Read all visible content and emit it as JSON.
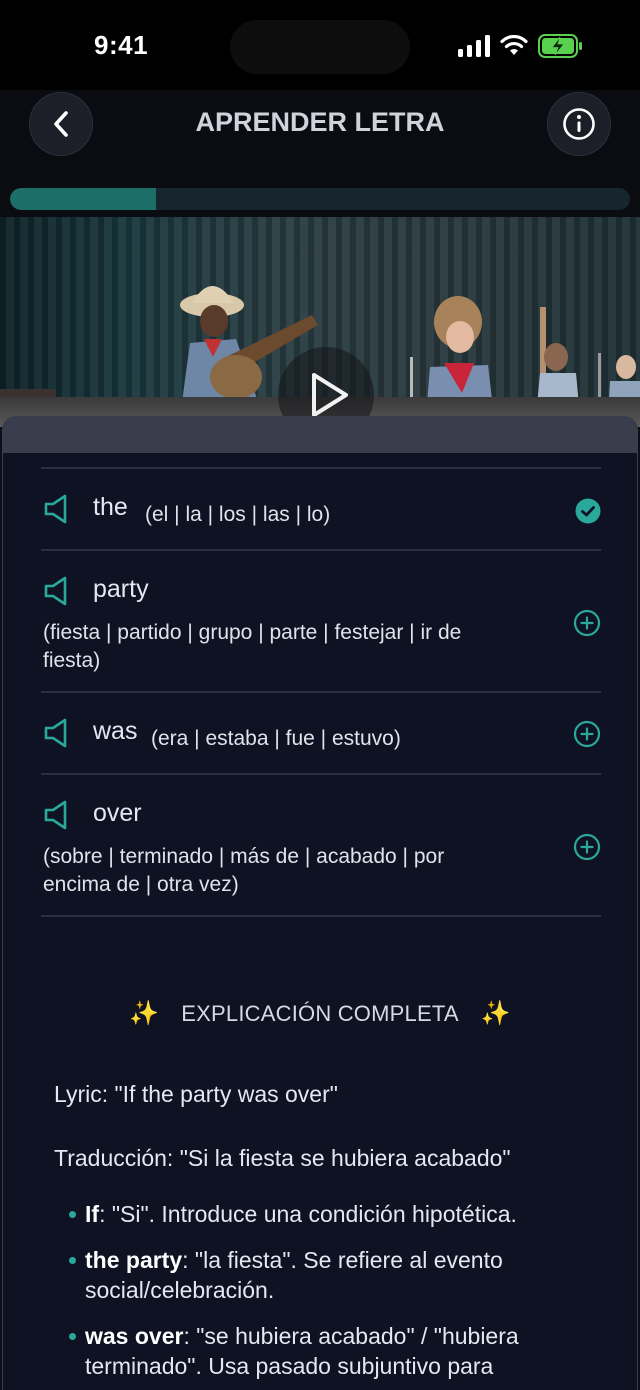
{
  "status_bar": {
    "time": "9:41"
  },
  "header": {
    "title": "APRENDER LETRA",
    "progress_fraction": 0.235
  },
  "words": [
    {
      "word": "the",
      "translation": "(el | la | los | las | lo)",
      "status": "learned"
    },
    {
      "word": "party",
      "translation": "(fiesta | partido | grupo | parte | festejar | ir de fiesta)",
      "status": "add"
    },
    {
      "word": "was",
      "translation": "(era | estaba | fue | estuvo)",
      "status": "add"
    },
    {
      "word": "over",
      "translation": "(sobre | terminado | más de | acabado | por encima de | otra vez)",
      "status": "add"
    }
  ],
  "explanation": {
    "title": "EXPLICACIÓN COMPLETA",
    "sparkle": "✨",
    "lyric": "Lyric: \"If the party was over\"",
    "translation": "Traducción: \"Si la fiesta se hubiera acabado\"",
    "bullets": [
      {
        "term": "If",
        "text": ": \"Si\". Introduce una condición hipotética."
      },
      {
        "term": "the party",
        "text": ": \"la fiesta\". Se refiere al evento social/celebración."
      },
      {
        "term": "was over",
        "text": ": \"se hubiera acabado\" / \"hubiera terminado\". Usa pasado subjuntivo para"
      }
    ]
  },
  "colors": {
    "accent": "#2aa89b",
    "progress": "#1b6f68",
    "sheet": "#0e1223"
  }
}
